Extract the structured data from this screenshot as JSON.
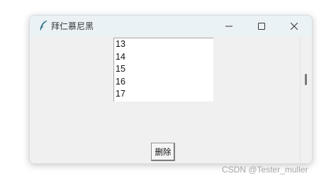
{
  "window": {
    "title": "拜仁慕尼黑",
    "app_icon": "feather-icon",
    "controls": {
      "minimize_icon": "minimize-icon",
      "maximize_icon": "maximize-icon",
      "close_icon": "close-icon"
    }
  },
  "listbox": {
    "items": [
      "13",
      "14",
      "15",
      "16",
      "17"
    ]
  },
  "delete_button": {
    "label": "删除"
  },
  "watermark": {
    "text": "CSDN @Tester_muller"
  },
  "colors": {
    "titlebar": "#eaf2f5",
    "window_bg": "#f0f0f0",
    "feather_icon": "#2f6f8f"
  }
}
